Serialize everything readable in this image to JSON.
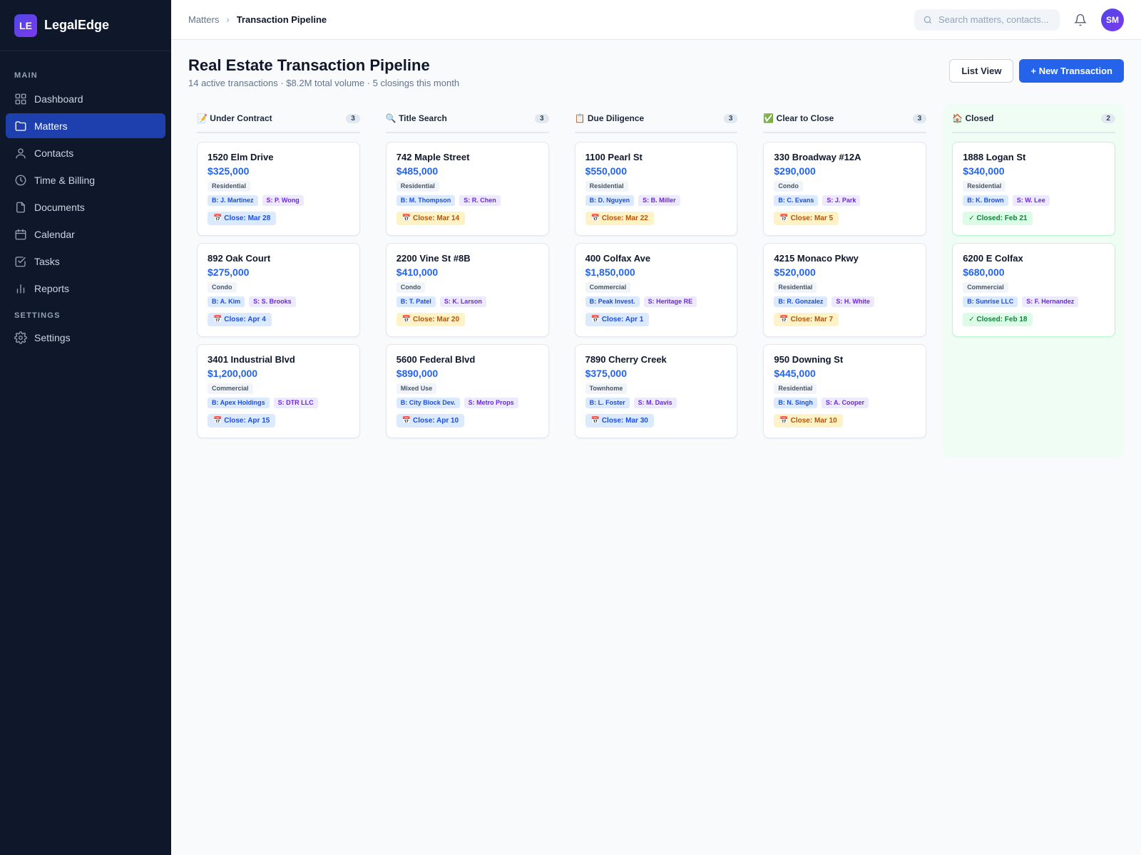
{
  "brand": {
    "logo_text": "LE",
    "name": "LegalEdge"
  },
  "sidebar": {
    "main_heading": "MAIN",
    "settings_heading": "SETTINGS",
    "items": [
      {
        "label": "Dashboard",
        "icon": "dashboard-icon"
      },
      {
        "label": "Matters",
        "icon": "folder-icon",
        "active": true
      },
      {
        "label": "Contacts",
        "icon": "user-icon"
      },
      {
        "label": "Time & Billing",
        "icon": "clock-icon"
      },
      {
        "label": "Documents",
        "icon": "document-icon"
      },
      {
        "label": "Calendar",
        "icon": "calendar-icon"
      },
      {
        "label": "Tasks",
        "icon": "checkbox-icon"
      },
      {
        "label": "Reports",
        "icon": "bar-chart-icon"
      }
    ],
    "settings_items": [
      {
        "label": "Settings",
        "icon": "gear-icon"
      }
    ]
  },
  "topbar": {
    "breadcrumb": {
      "parent": "Matters",
      "separator": "›",
      "current": "Transaction Pipeline"
    },
    "search_placeholder": "Search matters, contacts...",
    "avatar_initials": "SM"
  },
  "page": {
    "title": "Real Estate Transaction Pipeline",
    "subtitle": "14 active transactions · $8.2M total volume · 5 closings this month",
    "list_view_label": "List View",
    "new_transaction_label": "+ New Transaction"
  },
  "colors": {
    "accent": "#2563eb",
    "sidebar_bg": "#0f172a",
    "active_nav": "#1e40af",
    "closed_column_bg": "#f0fdf4"
  },
  "columns": [
    {
      "title": "📝 Under Contract",
      "count": "3",
      "cards": [
        {
          "address": "1520 Elm Drive",
          "price": "$325,000",
          "type": "Residential",
          "buyer": "B: J. Martinez",
          "seller": "S: P. Wong",
          "close": "📅 Close: Mar 28",
          "close_color": "blue"
        },
        {
          "address": "892 Oak Court",
          "price": "$275,000",
          "type": "Condo",
          "buyer": "B: A. Kim",
          "seller": "S: S. Brooks",
          "close": "📅 Close: Apr 4",
          "close_color": "blue"
        },
        {
          "address": "3401 Industrial Blvd",
          "price": "$1,200,000",
          "type": "Commercial",
          "buyer": "B: Apex Holdings",
          "seller": "S: DTR LLC",
          "close": "📅 Close: Apr 15",
          "close_color": "blue"
        }
      ]
    },
    {
      "title": "🔍 Title Search",
      "count": "3",
      "cards": [
        {
          "address": "742 Maple Street",
          "price": "$485,000",
          "type": "Residential",
          "buyer": "B: M. Thompson",
          "seller": "S: R. Chen",
          "close": "📅 Close: Mar 14",
          "close_color": "amber"
        },
        {
          "address": "2200 Vine St #8B",
          "price": "$410,000",
          "type": "Condo",
          "buyer": "B: T. Patel",
          "seller": "S: K. Larson",
          "close": "📅 Close: Mar 20",
          "close_color": "amber"
        },
        {
          "address": "5600 Federal Blvd",
          "price": "$890,000",
          "type": "Mixed Use",
          "buyer": "B: City Block Dev.",
          "seller": "S: Metro Props",
          "close": "📅 Close: Apr 10",
          "close_color": "blue"
        }
      ]
    },
    {
      "title": "📋 Due Diligence",
      "count": "3",
      "cards": [
        {
          "address": "1100 Pearl St",
          "price": "$550,000",
          "type": "Residential",
          "buyer": "B: D. Nguyen",
          "seller": "S: B. Miller",
          "close": "📅 Close: Mar 22",
          "close_color": "amber"
        },
        {
          "address": "400 Colfax Ave",
          "price": "$1,850,000",
          "type": "Commercial",
          "buyer": "B: Peak Invest.",
          "seller": "S: Heritage RE",
          "close": "📅 Close: Apr 1",
          "close_color": "blue"
        },
        {
          "address": "7890 Cherry Creek",
          "price": "$375,000",
          "type": "Townhome",
          "buyer": "B: L. Foster",
          "seller": "S: M. Davis",
          "close": "📅 Close: Mar 30",
          "close_color": "blue"
        }
      ]
    },
    {
      "title": "✅ Clear to Close",
      "count": "3",
      "cards": [
        {
          "address": "330 Broadway #12A",
          "price": "$290,000",
          "type": "Condo",
          "buyer": "B: C. Evans",
          "seller": "S: J. Park",
          "close": "📅 Close: Mar 5",
          "close_color": "amber"
        },
        {
          "address": "4215 Monaco Pkwy",
          "price": "$520,000",
          "type": "Residential",
          "buyer": "B: R. Gonzalez",
          "seller": "S: H. White",
          "close": "📅 Close: Mar 7",
          "close_color": "amber"
        },
        {
          "address": "950 Downing St",
          "price": "$445,000",
          "type": "Residential",
          "buyer": "B: N. Singh",
          "seller": "S: A. Cooper",
          "close": "📅 Close: Mar 10",
          "close_color": "amber"
        }
      ]
    },
    {
      "title": "🏠 Closed",
      "count": "2",
      "closed": true,
      "cards": [
        {
          "address": "1888 Logan St",
          "price": "$340,000",
          "type": "Residential",
          "buyer": "B: K. Brown",
          "seller": "S: W. Lee",
          "close": "✓ Closed: Feb 21",
          "close_color": "green"
        },
        {
          "address": "6200 E Colfax",
          "price": "$680,000",
          "type": "Commercial",
          "buyer": "B: Sunrise LLC",
          "seller": "S: F. Hernandez",
          "close": "✓ Closed: Feb 18",
          "close_color": "green"
        }
      ]
    }
  ]
}
